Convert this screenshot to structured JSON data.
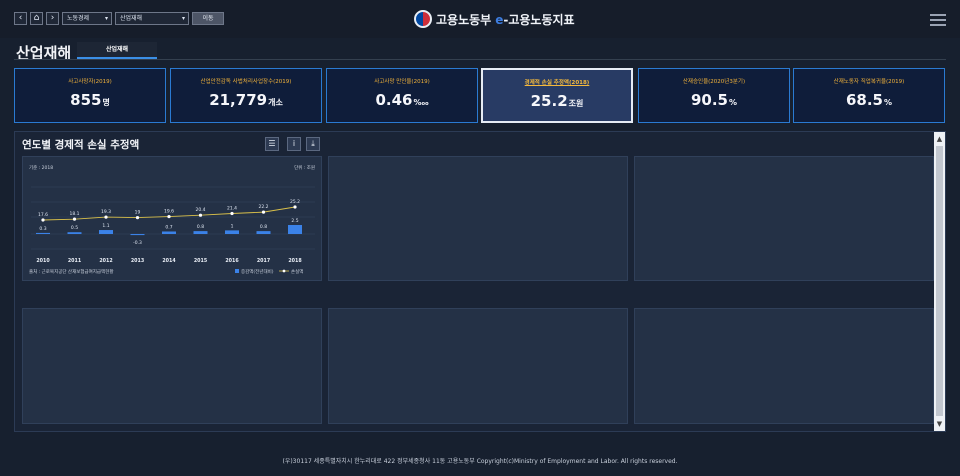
{
  "nav": {
    "back_icon": "‹",
    "home_icon": "⌂",
    "forward_icon": "›",
    "select1": "노동경제",
    "select2": "산업재해",
    "go_label": "이동"
  },
  "brand": {
    "text1": "고용노동부",
    "e": "e",
    "text2": "-고용노동지표"
  },
  "page": {
    "title": "산업재해",
    "tab": "산업재해"
  },
  "kpis": [
    {
      "label": "사고사망자(2019)",
      "value": "855",
      "unit": "명"
    },
    {
      "label": "산업안전감독 사법처리사업장수(2019)",
      "value": "21,779",
      "unit": "개소"
    },
    {
      "label": "사고사망 만인율(2019)",
      "value": "0.46",
      "unit": "‱"
    },
    {
      "label": "경제적 손실 추정액(2018)",
      "value": "25.2",
      "unit": "조원"
    },
    {
      "label": "산재승인율(2020년3분기)",
      "value": "90.5",
      "unit": "%"
    },
    {
      "label": "산재노동자 직업복귀율(2019)",
      "value": "68.5",
      "unit": "%"
    }
  ],
  "chart_title": "연도별 경제적 손실 추정액",
  "chart_data": {
    "type": "bar+line",
    "note_left": "기준 : 2018",
    "note_right": "단위 : 조원",
    "categories": [
      "2010",
      "2011",
      "2012",
      "2013",
      "2014",
      "2015",
      "2016",
      "2017",
      "2018"
    ],
    "series": [
      {
        "name": "증감액(전년대비)",
        "type": "bar",
        "values": [
          0.3,
          0.5,
          1.1,
          -0.3,
          0.7,
          0.8,
          1,
          0.8,
          2.5
        ],
        "labels": [
          "0.3",
          "0.5",
          "1.1",
          "-0.3",
          "0.7",
          "0.8",
          "1",
          "0.8",
          "2.5"
        ],
        "color": "#3b82e8"
      },
      {
        "name": "손실액",
        "type": "line",
        "values": [
          17.6,
          18.1,
          19.3,
          19,
          19.6,
          20.4,
          21.4,
          22.2,
          25.2
        ],
        "labels": [
          "17.6",
          "18.1",
          "19.3",
          "19",
          "19.6",
          "20.4",
          "21.4",
          "22.2",
          "25.2"
        ],
        "color": "#d9c04a"
      }
    ],
    "source": "출처 : 근로복지공단 산재보험급여지급액현황"
  },
  "footer": "(우)30117 세종특별자치시 한누리대로 422 정부세종청사 11동 고용노동부 Copyright(c)Ministry of Employment and Labor. All rights reserved.",
  "colors": {
    "accent": "#2a7ad1",
    "kpi_label": "#f2b33a",
    "bar": "#3b82e8",
    "line": "#d9c04a"
  }
}
